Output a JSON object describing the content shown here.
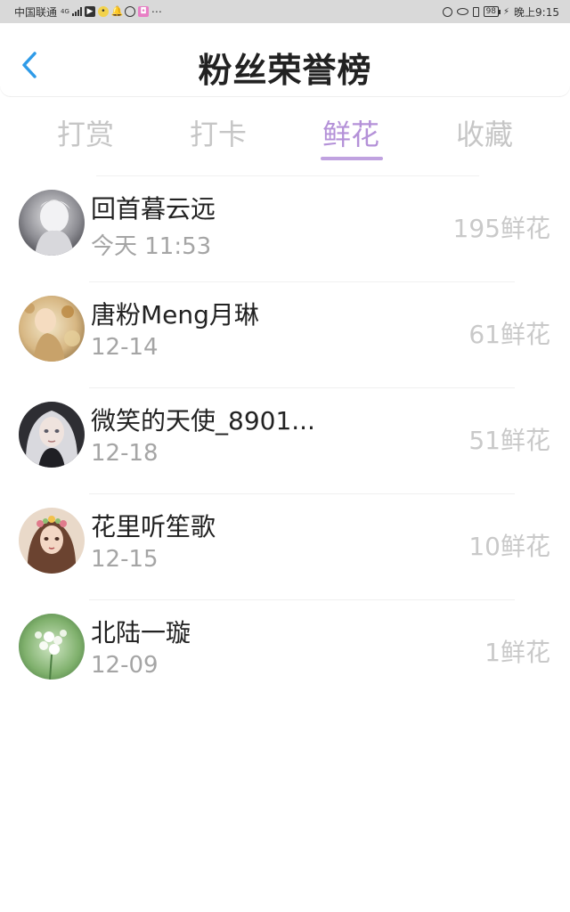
{
  "status_bar": {
    "carrier": "中国联通",
    "network": "4G",
    "battery": "98",
    "time": "晚上9:15"
  },
  "header": {
    "title": "粉丝荣誉榜"
  },
  "tabs": [
    {
      "label": "打赏",
      "active": false
    },
    {
      "label": "打卡",
      "active": false
    },
    {
      "label": "鲜花",
      "active": true
    },
    {
      "label": "收藏",
      "active": false
    }
  ],
  "colors": {
    "accent": "#b491d8",
    "back_icon": "#2f9be8",
    "muted_text": "#a5a5a5",
    "count_text": "#c9c9c9"
  },
  "fans": [
    {
      "name": "回首暮云远",
      "time": "今天 11:53",
      "count": "195鲜花",
      "avatar_icon": "avatar-white-hair-figure"
    },
    {
      "name": "唐粉Meng月琳",
      "time": "12-14",
      "count": "61鲜花",
      "avatar_icon": "avatar-autumn-leaves-figure"
    },
    {
      "name": "微笑的天使_8901...",
      "time": "12-18",
      "count": "51鲜花",
      "avatar_icon": "avatar-silver-hair-girl"
    },
    {
      "name": "花里听笙歌",
      "time": "12-15",
      "count": "10鲜花",
      "avatar_icon": "avatar-flower-crown-girl"
    },
    {
      "name": "北陆一璇",
      "time": "12-09",
      "count": "1鲜花",
      "avatar_icon": "avatar-white-flowers"
    }
  ]
}
